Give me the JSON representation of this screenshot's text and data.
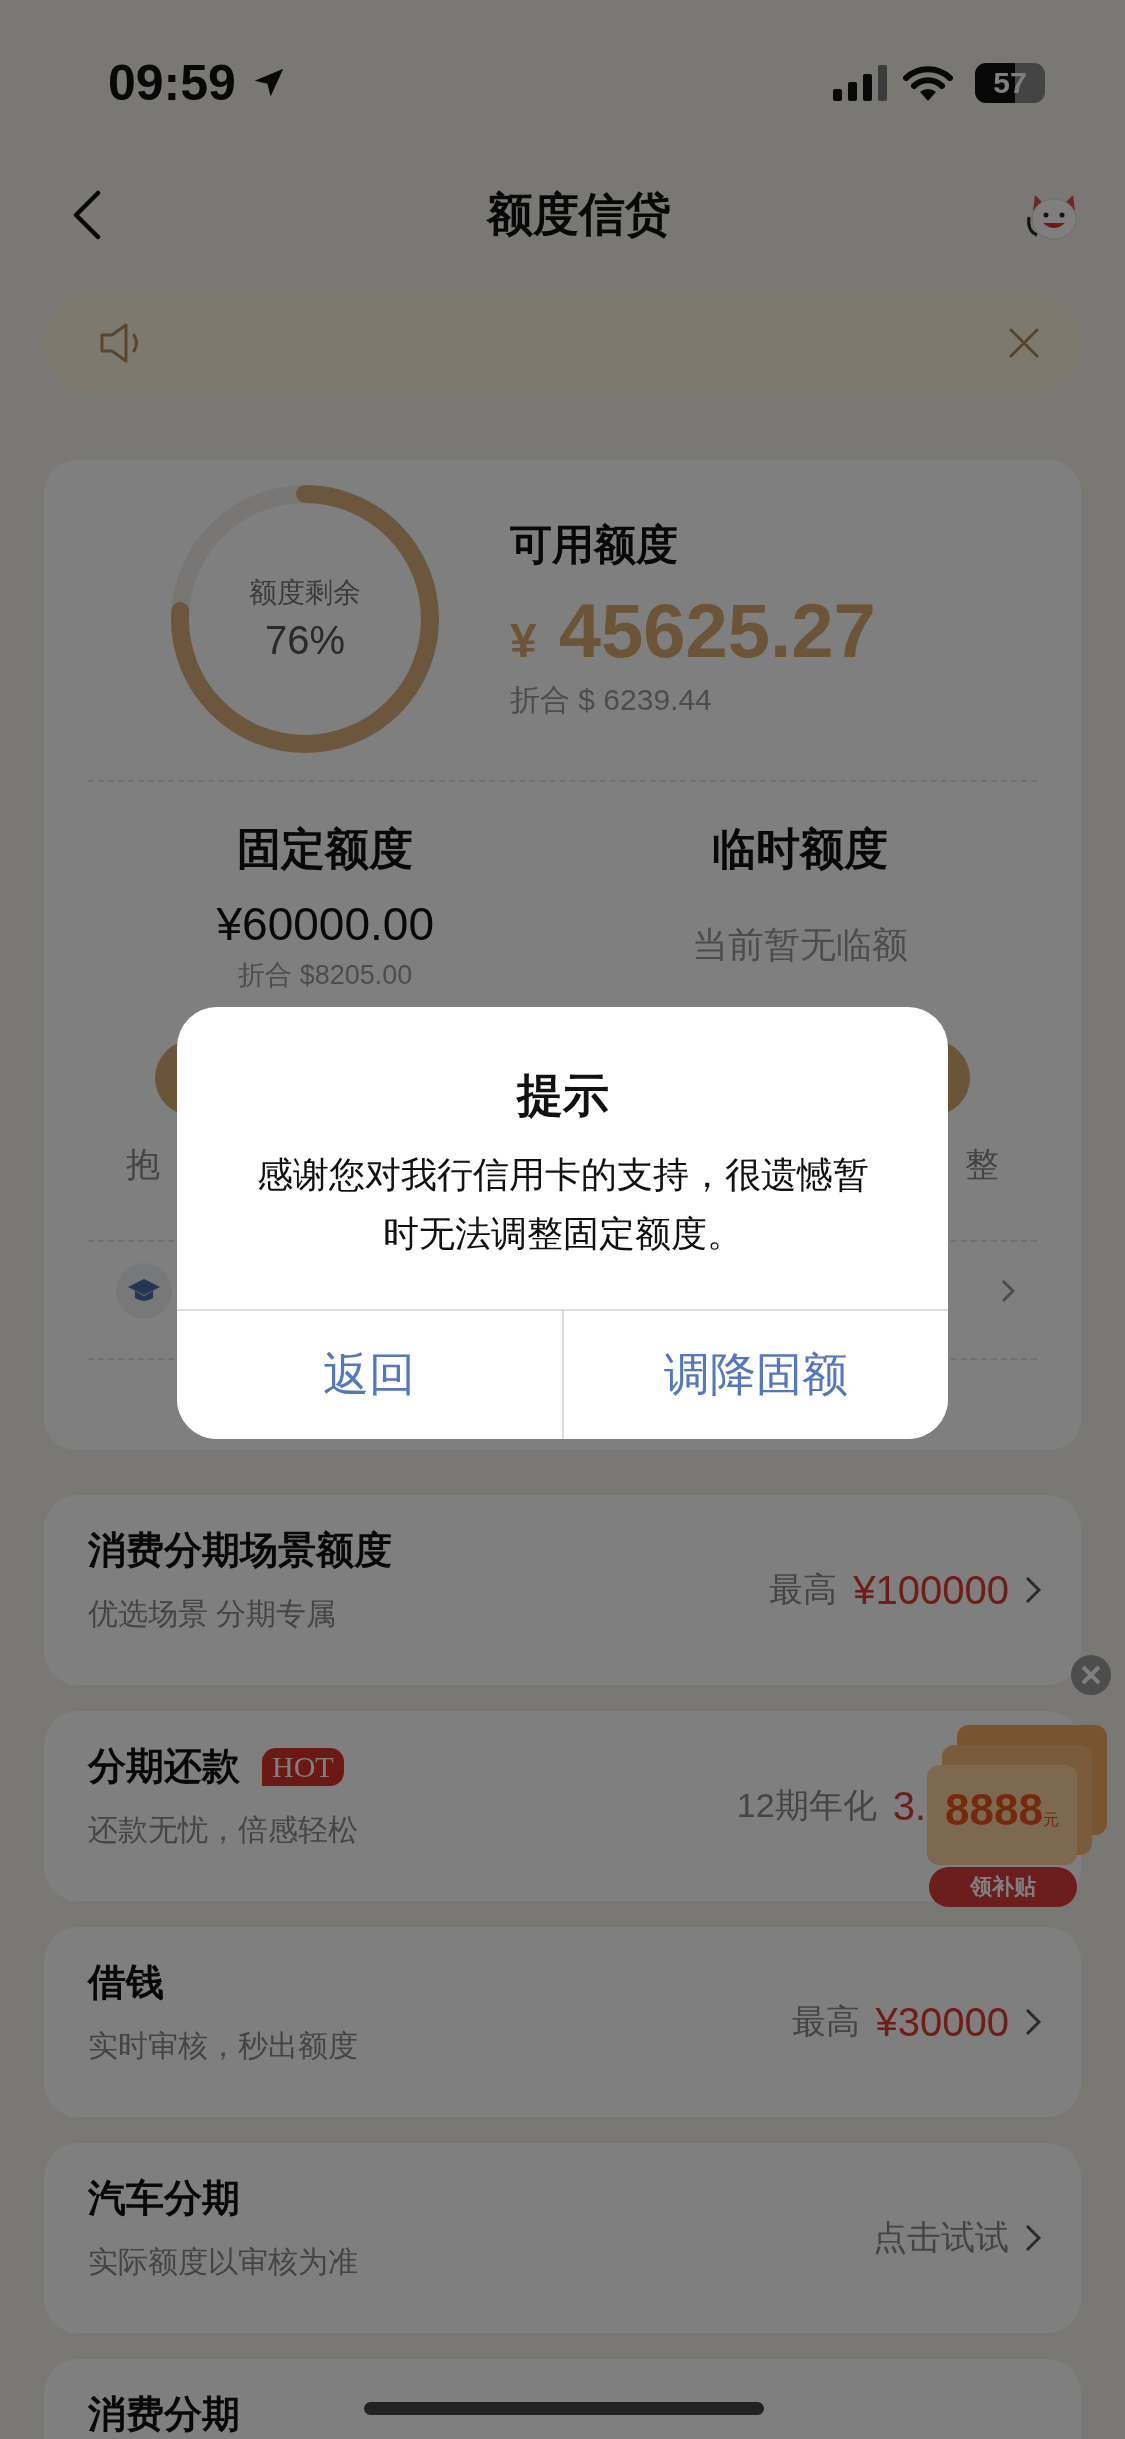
{
  "status_bar": {
    "time": "09:59",
    "battery": "57"
  },
  "nav": {
    "title": "额度信贷"
  },
  "credit": {
    "ring_label": "额度剩余",
    "ring_value": "76%",
    "level": 0.76,
    "title": "可用额度",
    "currency": "¥",
    "amount": "45625.27",
    "converted": "折合 $ 6239.44"
  },
  "fixed": {
    "title": "固定额度",
    "amount": "¥60000.00",
    "converted": "折合 $8205.00",
    "note": "抱"
  },
  "temporary": {
    "title": "临时额度",
    "status": "当前暂无临额",
    "note": "整"
  },
  "dialog": {
    "title": "提示",
    "message": "感谢您对我行信用卡的支持，很遗憾暂时无法调整固定额度。",
    "buttons": [
      "返回",
      "调降固额"
    ]
  },
  "products": [
    {
      "title": "消费分期场景额度",
      "subtitle": "优选场景 分期专属",
      "label": "最高",
      "value": "¥100000"
    },
    {
      "title": "分期还款",
      "badge": "HOT",
      "subtitle": "还款无忧，倍感轻松",
      "label": "12期年化",
      "value": "3.",
      "promo": {
        "amount": "8888",
        "unit": "元",
        "button": "领补贴"
      }
    },
    {
      "title": "借钱",
      "subtitle": "实时审核，秒出额度",
      "label": "最高",
      "value": "¥30000"
    },
    {
      "title": "汽车分期",
      "subtitle": "实际额度以审核为准",
      "label": "点击试试"
    },
    {
      "title": "消费分期"
    }
  ]
}
